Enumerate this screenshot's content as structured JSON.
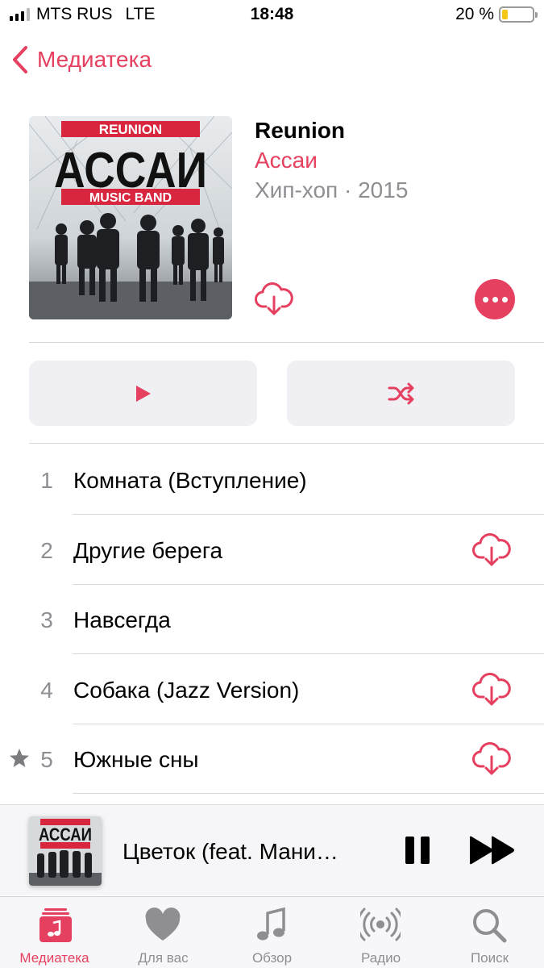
{
  "status_bar": {
    "carrier": "MTS RUS",
    "network": "LTE",
    "time": "18:48",
    "battery_text": "20 %",
    "battery_level": 0.2
  },
  "nav": {
    "back_label": "Медиатека"
  },
  "album": {
    "title": "Reunion",
    "artist": "Ассаи",
    "meta": "Хип-хоп · 2015",
    "cover_text": {
      "top": "REUNION",
      "main": "АССАИ",
      "bottom": "MUSIC BAND"
    }
  },
  "actions": {
    "play_icon": "play-icon",
    "shuffle_icon": "shuffle-icon"
  },
  "tracks": [
    {
      "number": "1",
      "title": "Комната (Вступление)",
      "downloadable": false,
      "starred": false
    },
    {
      "number": "2",
      "title": "Другие берега",
      "downloadable": true,
      "starred": false
    },
    {
      "number": "3",
      "title": "Навсегда",
      "downloadable": false,
      "starred": false
    },
    {
      "number": "4",
      "title": "Собака (Jazz Version)",
      "downloadable": true,
      "starred": false
    },
    {
      "number": "5",
      "title": "Южные сны",
      "downloadable": true,
      "starred": true
    }
  ],
  "now_playing": {
    "title": "Цветок (feat. Мани…"
  },
  "tab_bar": {
    "tabs": [
      {
        "label": "Медиатека",
        "icon": "library-icon",
        "active": true
      },
      {
        "label": "Для вас",
        "icon": "heart-icon",
        "active": false
      },
      {
        "label": "Обзор",
        "icon": "music-note-icon",
        "active": false
      },
      {
        "label": "Радио",
        "icon": "radio-icon",
        "active": false
      },
      {
        "label": "Поиск",
        "icon": "search-icon",
        "active": false
      }
    ]
  },
  "colors": {
    "accent": "#e5405f",
    "secondary_text": "#8e8e93",
    "button_bg": "#efeff4"
  }
}
